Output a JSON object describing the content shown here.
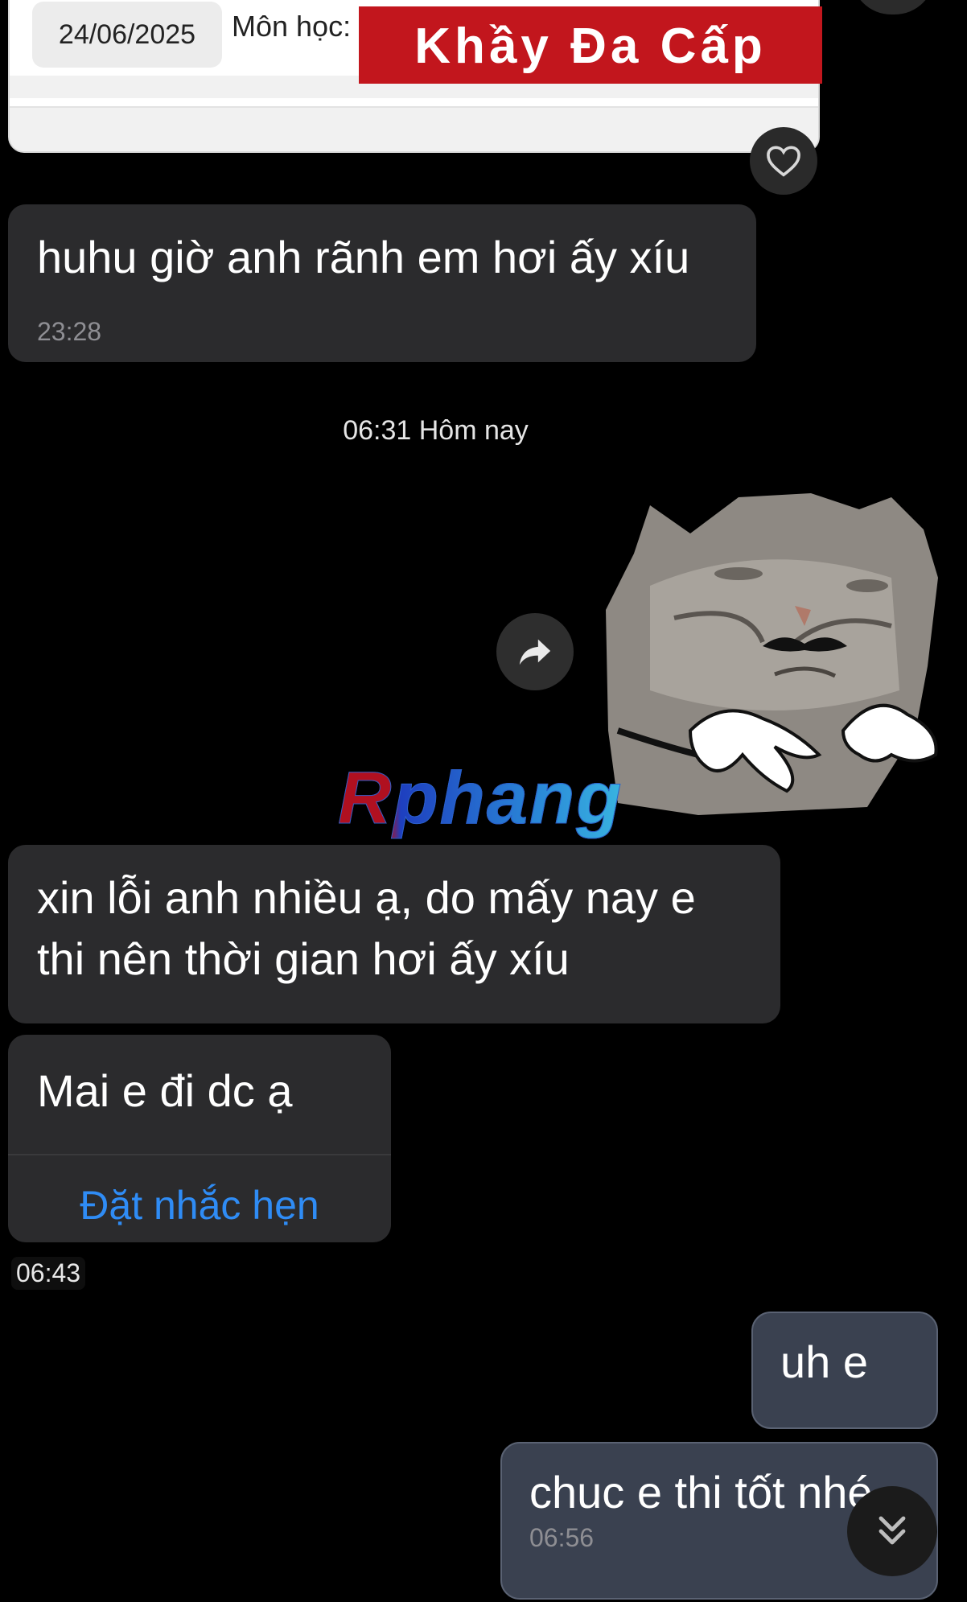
{
  "shared_card": {
    "date": "24/06/2025",
    "subject_label": "Môn học:",
    "banner_text": "Khầy Đa Cấp"
  },
  "messages": [
    {
      "text": "huhu giờ anh rãnh em hơi ấy xíu",
      "time": "23:28"
    },
    {
      "text_line1": "xin lỗi anh nhiều ạ, do mấy nay e",
      "text_line2": "thi nên thời gian hơi ấy xíu"
    },
    {
      "text": "Mai e đi dc ạ",
      "action": "Đặt nhắc hẹn",
      "time": "06:43"
    },
    {
      "text": "uh e"
    },
    {
      "text": "chuc e thi tốt nhé",
      "time": "06:56"
    }
  ],
  "date_separator": "06:31 Hôm nay",
  "watermark": "Rphang",
  "icons": {
    "heart": "heart-icon",
    "forward": "forward-arrow-icon",
    "scroll_down": "double-chevron-down-icon"
  },
  "colors": {
    "background": "#000000",
    "incoming_bubble": "#2b2b2d",
    "outgoing_bubble": "#3a4150",
    "link_blue": "#2f8cf5",
    "banner_red": "#c2161d"
  }
}
